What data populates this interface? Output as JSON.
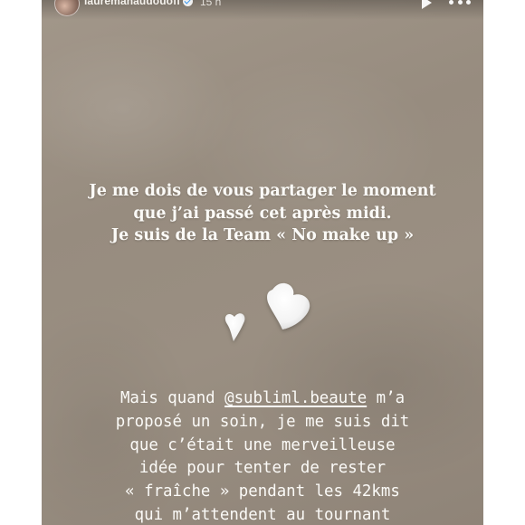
{
  "story": {
    "username": "lauremanaudouoff",
    "timestamp": "15 h",
    "verified": true,
    "icons": {
      "avatar": "profile-avatar",
      "verified": "verified-badge-icon",
      "play": "play-icon",
      "more": "more-options-icon"
    },
    "headline": {
      "line1": "Je me dois de vous partager le moment",
      "line2": "que j’ai passé cet après midi.",
      "line3": "Je suis de la Team « No make up »"
    },
    "sticker": "two-white-hearts",
    "body": {
      "line1_before": "Mais quand ",
      "mention": "@subliml.beaute",
      "line1_after": " m’a",
      "line2": "proposé un soin, je me suis dit",
      "line3": "que c’était une merveilleuse",
      "line4": "idée pour tenter de rester",
      "line5": "« fraîche » pendant les 42kms",
      "line6": "qui m’attendent au tournant"
    }
  },
  "colors": {
    "background": "#9a8f82",
    "text": "#fbfaf7",
    "verified_check": "#3897f0"
  }
}
